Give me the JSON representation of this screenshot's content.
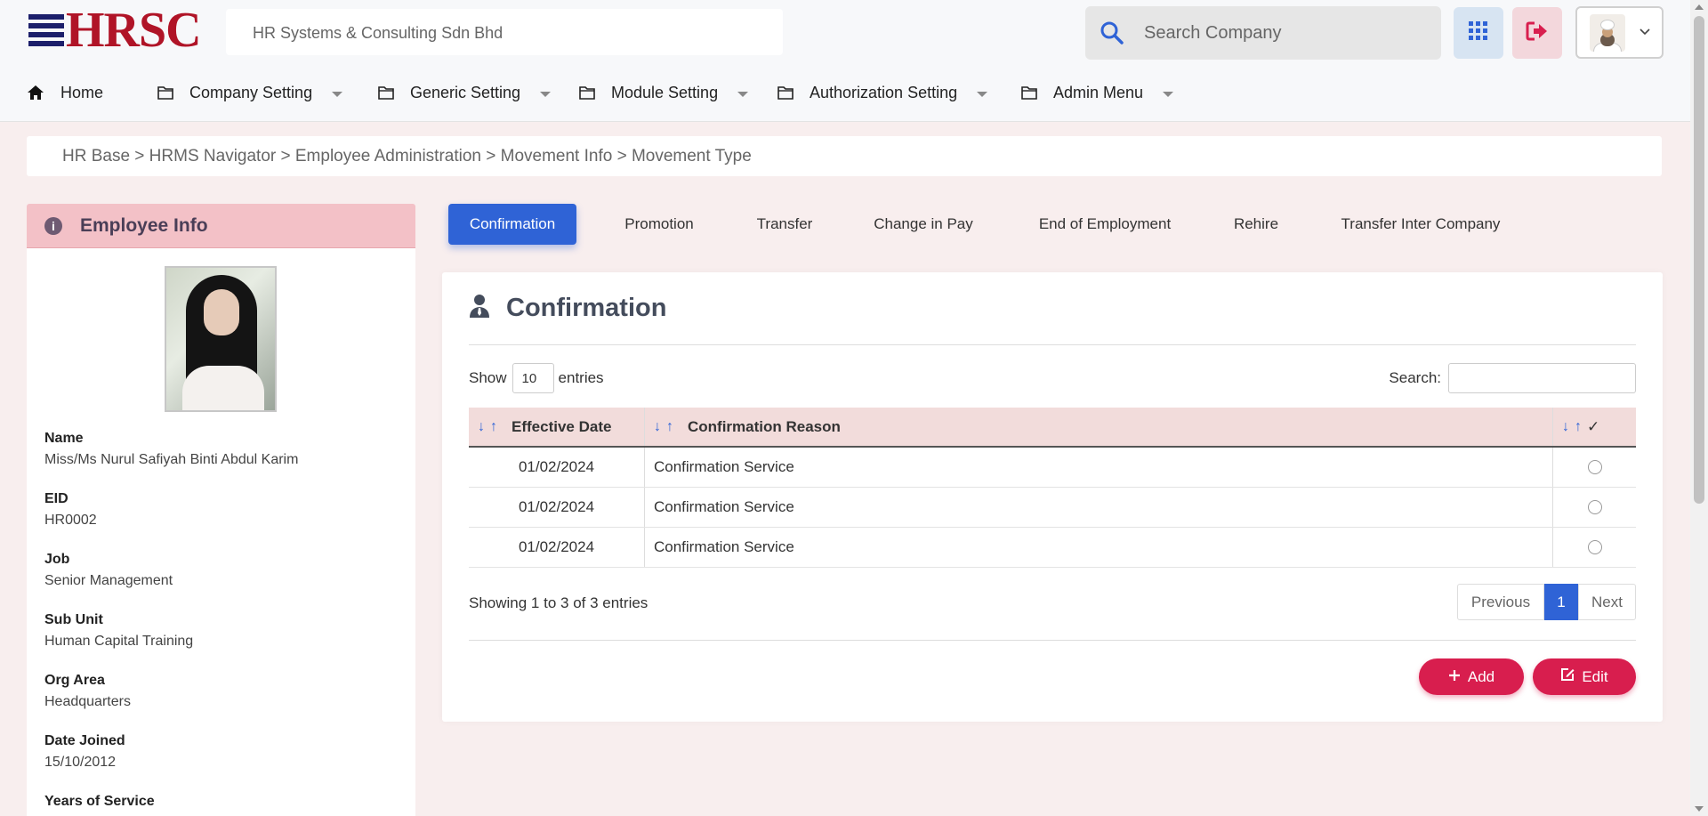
{
  "header": {
    "logo_text": "HRSC",
    "company_name": "HR Systems & Consulting Sdn Bhd",
    "search_placeholder": "Search Company"
  },
  "nav": {
    "items": [
      {
        "label": "Home",
        "icon": "home-icon",
        "dropdown": false
      },
      {
        "label": "Company Setting",
        "icon": "folder-icon",
        "dropdown": true
      },
      {
        "label": "Generic Setting",
        "icon": "folder-icon",
        "dropdown": true
      },
      {
        "label": "Module Setting",
        "icon": "folder-icon",
        "dropdown": true
      },
      {
        "label": "Authorization Setting",
        "icon": "folder-icon",
        "dropdown": true
      },
      {
        "label": "Admin Menu",
        "icon": "folder-icon",
        "dropdown": true
      }
    ]
  },
  "breadcrumb": "HR Base > HRMS Navigator > Employee Administration > Movement Info > Movement Type",
  "employee": {
    "panel_title": "Employee Info",
    "fields": [
      {
        "label": "Name",
        "value": "Miss/Ms Nurul Safiyah Binti Abdul Karim"
      },
      {
        "label": "EID",
        "value": "HR0002"
      },
      {
        "label": "Job",
        "value": "Senior Management"
      },
      {
        "label": "Sub Unit",
        "value": "Human Capital Training"
      },
      {
        "label": "Org Area",
        "value": "Headquarters"
      },
      {
        "label": "Date Joined",
        "value": "15/10/2012"
      },
      {
        "label": "Years of Service",
        "value": ""
      }
    ]
  },
  "tabs": [
    {
      "label": "Confirmation",
      "active": true
    },
    {
      "label": "Promotion",
      "active": false
    },
    {
      "label": "Transfer",
      "active": false
    },
    {
      "label": "Change in Pay",
      "active": false
    },
    {
      "label": "End of Employment",
      "active": false
    },
    {
      "label": "Rehire",
      "active": false
    },
    {
      "label": "Transfer Inter Company",
      "active": false
    }
  ],
  "main": {
    "title": "Confirmation",
    "show_label": "Show",
    "entries_value": "10",
    "entries_label": "entries",
    "search_label": "Search:",
    "columns": [
      "Effective Date",
      "Confirmation Reason",
      "✓"
    ],
    "sort_glyph": "↓↑",
    "rows": [
      {
        "date": "01/02/2024",
        "reason": "Confirmation Service"
      },
      {
        "date": "01/02/2024",
        "reason": "Confirmation Service"
      },
      {
        "date": "01/02/2024",
        "reason": "Confirmation Service"
      }
    ],
    "info": "Showing 1 to 3 of 3 entries",
    "pager": {
      "previous": "Previous",
      "page": "1",
      "next": "Next"
    },
    "add_label": "Add",
    "edit_label": "Edit"
  },
  "colors": {
    "accent": "#2f63d6",
    "danger": "#d81e4e",
    "panel_header": "#f3c1c7",
    "page_bg": "#f8eeee"
  }
}
